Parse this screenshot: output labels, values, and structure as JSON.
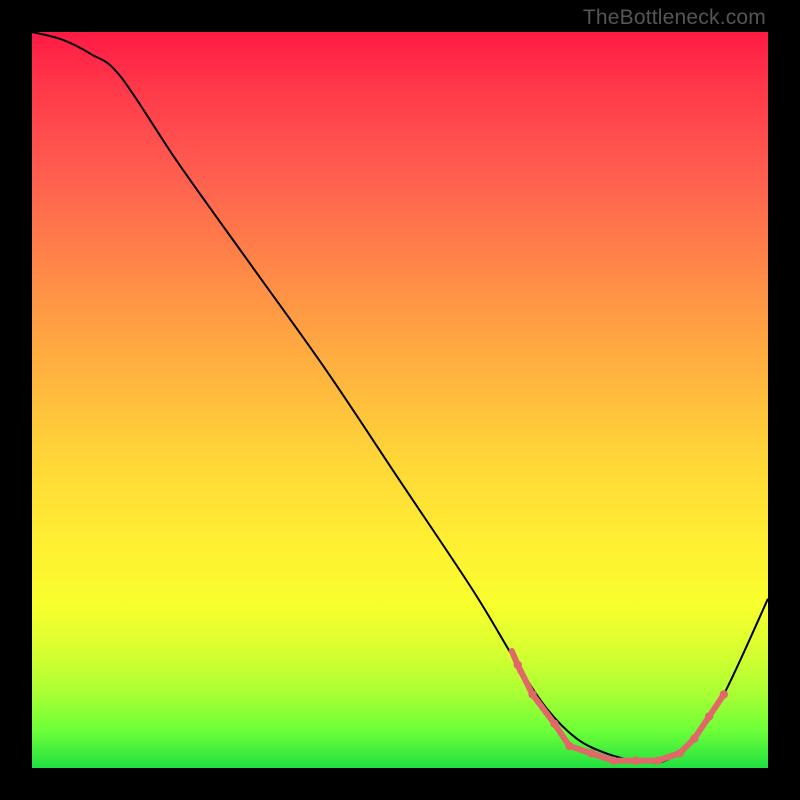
{
  "watermark": "TheBottleneck.com",
  "chart_data": {
    "type": "line",
    "title": "",
    "xlabel": "",
    "ylabel": "",
    "xlim": [
      0,
      100
    ],
    "ylim": [
      0,
      100
    ],
    "series": [
      {
        "name": "curve",
        "x": [
          0,
          4,
          8,
          12,
          20,
          30,
          40,
          50,
          60,
          66,
          70,
          74,
          78,
          82,
          86,
          90,
          94,
          100
        ],
        "y": [
          100,
          99,
          97,
          94,
          82,
          68,
          54,
          39,
          24,
          14,
          8,
          4,
          2,
          1,
          1,
          4,
          10,
          23
        ]
      }
    ],
    "markers": {
      "name": "highlight-dots",
      "color": "#e06868",
      "points": [
        {
          "x": 66,
          "y": 14
        },
        {
          "x": 68,
          "y": 10
        },
        {
          "x": 71,
          "y": 6
        },
        {
          "x": 73,
          "y": 3
        },
        {
          "x": 76,
          "y": 2
        },
        {
          "x": 79,
          "y": 1
        },
        {
          "x": 82,
          "y": 1
        },
        {
          "x": 85,
          "y": 1
        },
        {
          "x": 88,
          "y": 2
        },
        {
          "x": 90,
          "y": 4
        },
        {
          "x": 92,
          "y": 7
        },
        {
          "x": 94,
          "y": 10
        }
      ]
    }
  }
}
